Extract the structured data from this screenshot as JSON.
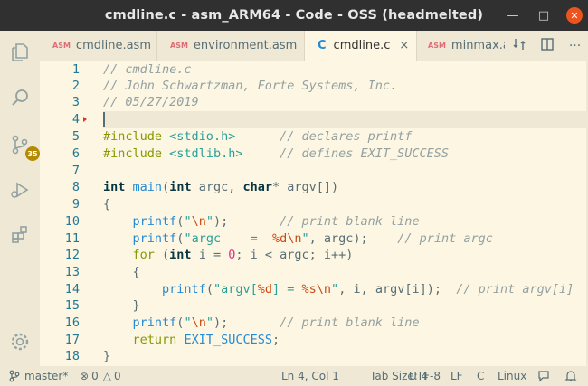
{
  "window": {
    "title": "cmdline.c - asm_ARM64 - Code - OSS (headmelted)"
  },
  "colors": {
    "accent_close": "#e95420",
    "badge": "#b58900",
    "background": "#fdf6e3",
    "sidebar": "#eee8d5"
  },
  "activity_bar": {
    "items": [
      {
        "name": "files-icon"
      },
      {
        "name": "search-icon"
      },
      {
        "name": "source-control-icon",
        "badge": "35"
      },
      {
        "name": "run-debug-icon"
      },
      {
        "name": "extensions-icon"
      },
      {
        "name": "settings-gear-icon"
      }
    ]
  },
  "tabs": [
    {
      "label": "cmdline.asm",
      "icon": "ASM"
    },
    {
      "label": "environment.asm",
      "icon": "ASM"
    },
    {
      "label": "cmdline.c",
      "icon": "C",
      "close": "×"
    },
    {
      "label": "minmax.as",
      "icon": "ASM"
    }
  ],
  "editor": {
    "line_numbers": [
      "1",
      "2",
      "3",
      "4",
      "5",
      "6",
      "7",
      "8",
      "9",
      "10",
      "11",
      "12",
      "13",
      "14",
      "15",
      "16",
      "17",
      "18"
    ],
    "lines": [
      "// cmdline.c",
      "// John Schwartzman, Forte Systems, Inc.",
      "// 05/27/2019",
      "",
      "#include <stdio.h>      // declares printf",
      "#include <stdlib.h>     // defines EXIT_SUCCESS",
      "",
      "int main(int argc, char* argv[])",
      "{",
      "    printf(\"\\n\");       // print blank line",
      "    printf(\"argc    =  %d\\n\", argc);    // print argc",
      "    for (int i = 0; i < argc; i++)",
      "    {",
      "        printf(\"argv[%d] = %s\\n\", i, argv[i]);  // print argv[i]",
      "    }",
      "    printf(\"\\n\");       // print blank line",
      "    return EXIT_SUCCESS;",
      "}"
    ]
  },
  "status_bar": {
    "branch": "master*",
    "errors": "0",
    "warnings": "0",
    "position": "Ln 4, Col 1",
    "tab_size": "Tab Size: 4",
    "encoding": "UTF-8",
    "eol": "LF",
    "language": "C",
    "os": "Linux"
  }
}
